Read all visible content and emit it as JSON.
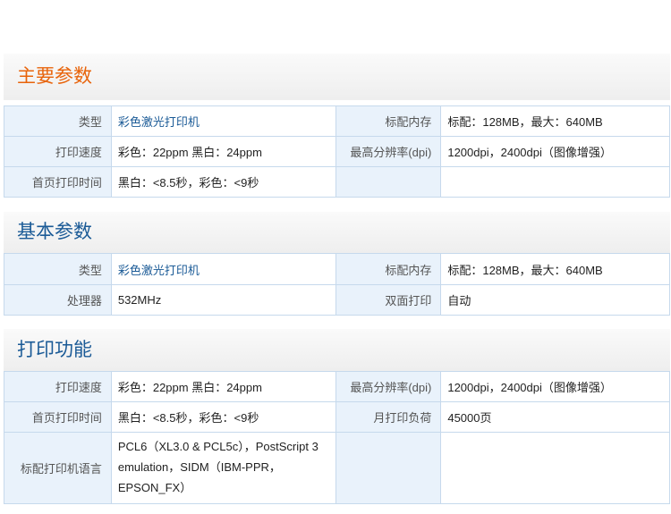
{
  "sections": [
    {
      "title": "主要参数",
      "rows": [
        {
          "l1": "类型",
          "v1": "彩色激光打印机",
          "l2": "标配内存",
          "v2": "标配：128MB，最大：640MB"
        },
        {
          "l1": "打印速度",
          "v1": "彩色：22ppm 黑白：24ppm",
          "l2": "最高分辨率(dpi)",
          "v2": "1200dpi，2400dpi（图像增强）"
        },
        {
          "l1": "首页打印时间",
          "v1": "黑白：<8.5秒，彩色：<9秒",
          "l2": "",
          "v2": ""
        }
      ]
    },
    {
      "title": "基本参数",
      "rows": [
        {
          "l1": "类型",
          "v1": "彩色激光打印机",
          "l2": "标配内存",
          "v2": "标配：128MB，最大：640MB"
        },
        {
          "l1": "处理器",
          "v1": "532MHz",
          "l2": "双面打印",
          "v2": "自动"
        }
      ]
    },
    {
      "title": "打印功能",
      "rows": [
        {
          "l1": "打印速度",
          "v1": "彩色：22ppm 黑白：24ppm",
          "l2": "最高分辨率(dpi)",
          "v2": "1200dpi，2400dpi（图像增强）"
        },
        {
          "l1": "首页打印时间",
          "v1": "黑白：<8.5秒，彩色：<9秒",
          "l2": "月打印负荷",
          "v2": "45000页"
        },
        {
          "l1": "标配打印机语言",
          "v1": "PCL6（XL3.0 & PCL5c），PostScript 3 emulation，SIDM（IBM-PPR，EPSON_FX）",
          "l2": "",
          "v2": ""
        }
      ]
    }
  ]
}
